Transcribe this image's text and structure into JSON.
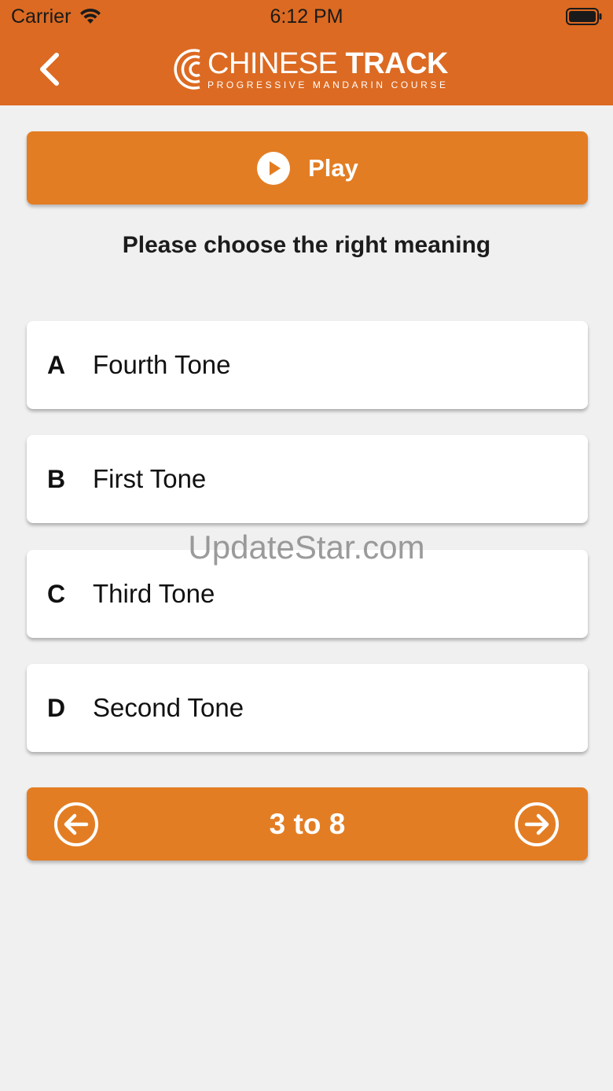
{
  "status_bar": {
    "carrier": "Carrier",
    "time": "6:12 PM"
  },
  "header": {
    "logo_light": "CHINESE",
    "logo_bold": "TRACK",
    "logo_subtitle": "PROGRESSIVE MANDARIN COURSE",
    "back_icon": "chevron-left-icon"
  },
  "play": {
    "label": "Play",
    "icon": "play-circle-icon"
  },
  "prompt": "Please choose the right meaning",
  "options": [
    {
      "letter": "A",
      "text": "Fourth Tone"
    },
    {
      "letter": "B",
      "text": "First Tone"
    },
    {
      "letter": "C",
      "text": "Third Tone"
    },
    {
      "letter": "D",
      "text": "Second Tone"
    }
  ],
  "watermark": "UpdateStar.com",
  "pager": {
    "label": "3 to 8",
    "prev_icon": "arrow-left-circle-icon",
    "next_icon": "arrow-right-circle-icon"
  },
  "colors": {
    "header": "#dc6a22",
    "button": "#e37d23",
    "background": "#f0f0f0"
  }
}
